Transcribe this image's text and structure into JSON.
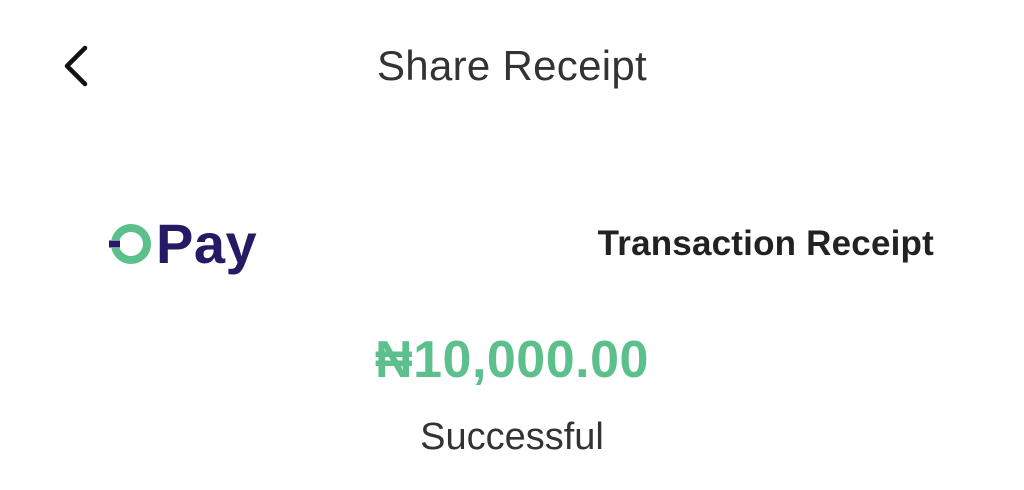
{
  "header": {
    "title": "Share Receipt",
    "back_icon": "chevron-left-icon"
  },
  "brand": {
    "logo_text": "Pay",
    "logo_mark_icon": "opay-ring-icon",
    "logo_mark_color": "#5cc08d",
    "logo_text_color": "#251a64"
  },
  "receipt": {
    "heading": "Transaction Receipt",
    "amount": "₦10,000.00",
    "amount_color": "#5cc08d",
    "status": "Successful"
  }
}
